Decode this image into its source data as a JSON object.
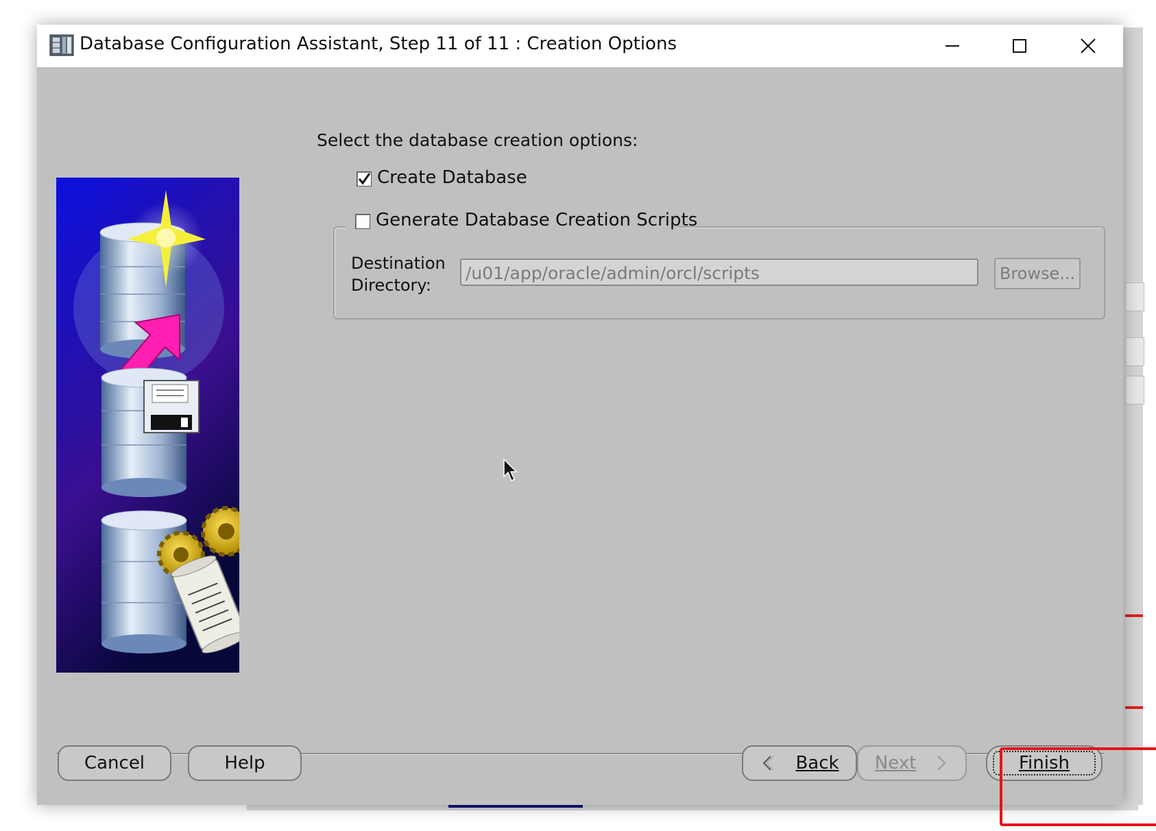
{
  "window": {
    "title": "Database Configuration Assistant, Step 11 of 11 : Creation Options",
    "controls": {
      "minimize": "─",
      "maximize": "☐",
      "close": "✕"
    }
  },
  "main": {
    "instruction": "Select the database creation options:",
    "create_database": {
      "label": "Create Database",
      "checked": true
    },
    "generate_scripts": {
      "label": "Generate Database Creation Scripts",
      "checked": false
    },
    "destination": {
      "label_line1": "Destination",
      "label_line2": "Directory:",
      "value": "/u01/app/oracle/admin/orcl/scripts",
      "browse_label": "Browse..."
    }
  },
  "buttons": {
    "cancel": "Cancel",
    "help": "Help",
    "back": "Back",
    "next": "Next",
    "finish": "Finish"
  },
  "colors": {
    "dialog_bg": "#c0c0c0",
    "highlight": "#e5141a",
    "image_bg_top": "#0b10e0",
    "image_bg_bottom": "#07073a",
    "arrow": "#ff1fb0"
  }
}
